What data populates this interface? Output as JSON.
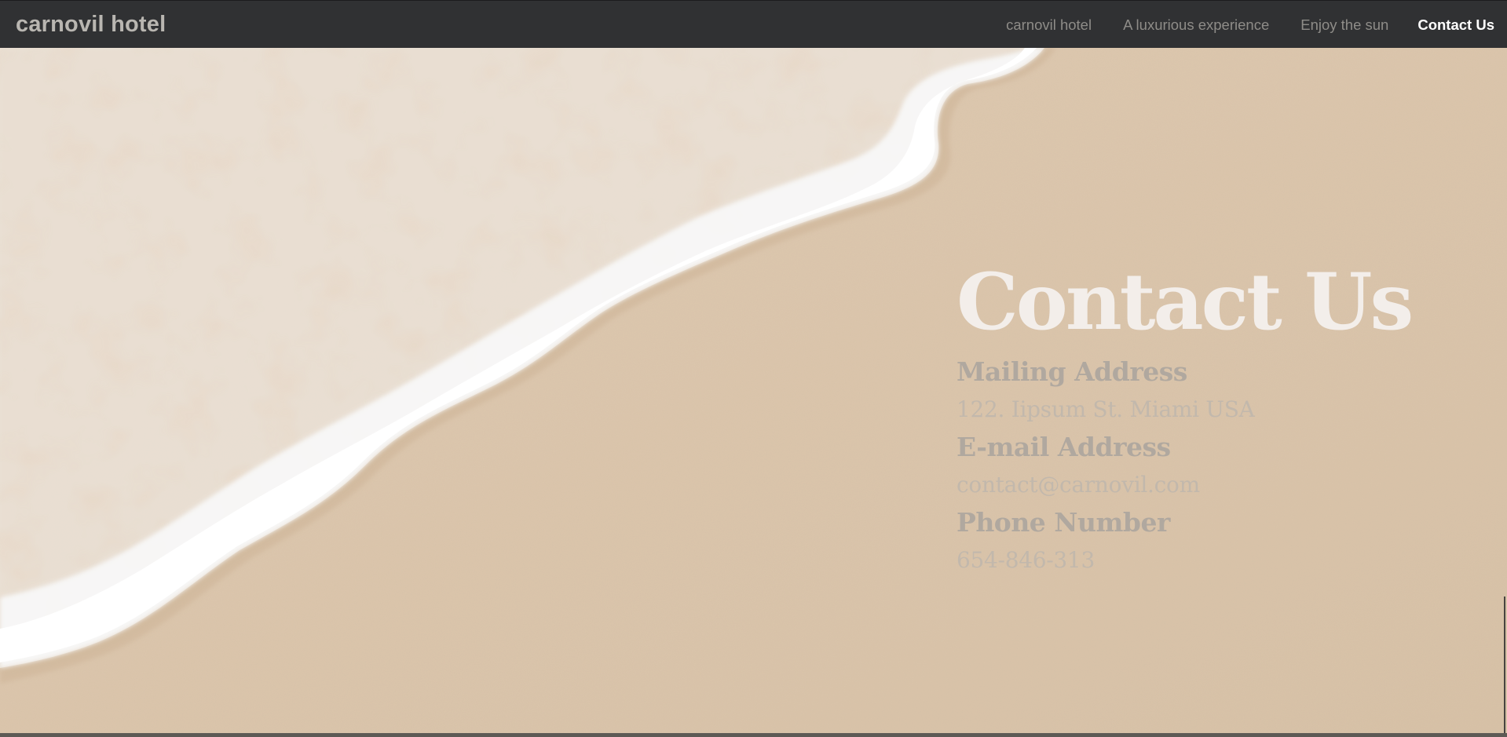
{
  "navbar": {
    "brand": "carnovil hotel",
    "links": [
      {
        "label": "carnovil hotel",
        "active": false
      },
      {
        "label": "A luxurious experience",
        "active": false
      },
      {
        "label": "Enjoy the sun",
        "active": false
      },
      {
        "label": "Contact Us",
        "active": true
      }
    ]
  },
  "contact": {
    "title": "Contact Us",
    "mailing_heading": "Mailing Address",
    "mailing_value": "122. Iipsum St. Miami USA",
    "email_heading": "E-mail Address",
    "email_value": "contact@carnovil.com",
    "phone_heading": "Phone Number",
    "phone_value": "654-846-313"
  },
  "colors": {
    "navbar_bg": "#303133",
    "brand_text": "#b9b6b1",
    "nav_link": "#8e8c88",
    "nav_active": "#ffffff",
    "sand": "#dcc7ae",
    "foam": "#f4f3f2",
    "title": "#f3eeea",
    "heading": "#b0a89f"
  }
}
